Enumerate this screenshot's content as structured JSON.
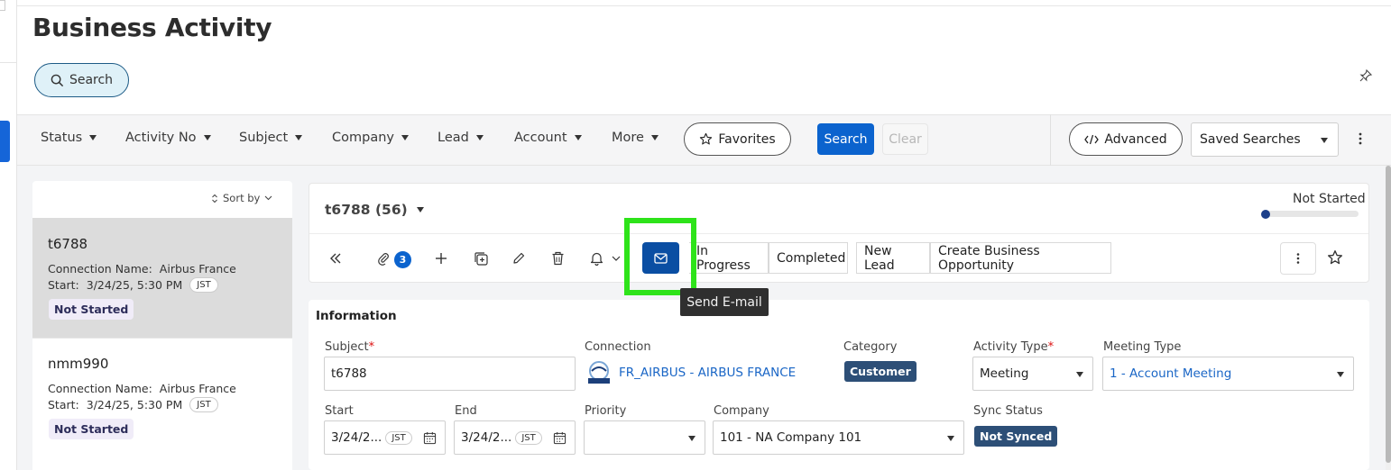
{
  "page": {
    "title": "Business Activity",
    "search_label": "Search"
  },
  "filters": {
    "items": [
      "Status",
      "Activity No",
      "Subject",
      "Company",
      "Lead",
      "Account",
      "More"
    ],
    "favorites_label": "Favorites",
    "search_label": "Search",
    "clear_label": "Clear",
    "advanced_label": "Advanced",
    "saved_searches_label": "Saved Searches"
  },
  "list": {
    "sort_label": "Sort by",
    "cards": [
      {
        "title": "t6788",
        "connection_label": "Connection Name:",
        "connection_value": "Airbus France",
        "start_label": "Start:",
        "start_value": "3/24/25, 5:30 PM",
        "tz": "JST",
        "status": "Not Started"
      },
      {
        "title": "nmm990",
        "connection_label": "Connection Name:",
        "connection_value": "Airbus France",
        "start_label": "Start:",
        "start_value": "3/24/25, 5:30 PM",
        "tz": "JST",
        "status": "Not Started"
      }
    ]
  },
  "record": {
    "title": "t6788 (56)",
    "status": "Not Started",
    "progress": 0,
    "attachment_count": "3",
    "buttons": {
      "in_progress": "In Progress",
      "completed": "Completed",
      "new_lead": "New Lead",
      "create_opportunity": "Create Business Opportunity"
    },
    "tooltip": "Send E-mail"
  },
  "info": {
    "section_title": "Information",
    "subject_label": "Subject",
    "subject_value": "t6788",
    "connection_label": "Connection",
    "connection_value": "FR_AIRBUS - AIRBUS FRANCE",
    "category_label": "Category",
    "category_value": "Customer",
    "activity_type_label": "Activity Type",
    "activity_type_value": "Meeting",
    "meeting_type_label": "Meeting Type",
    "meeting_type_value": "1 - Account Meeting",
    "start_label": "Start",
    "start_value": "3/24/2...",
    "end_label": "End",
    "end_value": "3/24/2...",
    "tz": "JST",
    "priority_label": "Priority",
    "priority_value": "",
    "company_label": "Company",
    "company_value": "101 - NA Company 101",
    "sync_label": "Sync Status",
    "sync_value": "Not Synced"
  },
  "colors": {
    "primary": "#0b63ce",
    "email_button": "#0a4ea3",
    "highlight": "#2ee31a",
    "category_tag": "#2d4f77"
  }
}
